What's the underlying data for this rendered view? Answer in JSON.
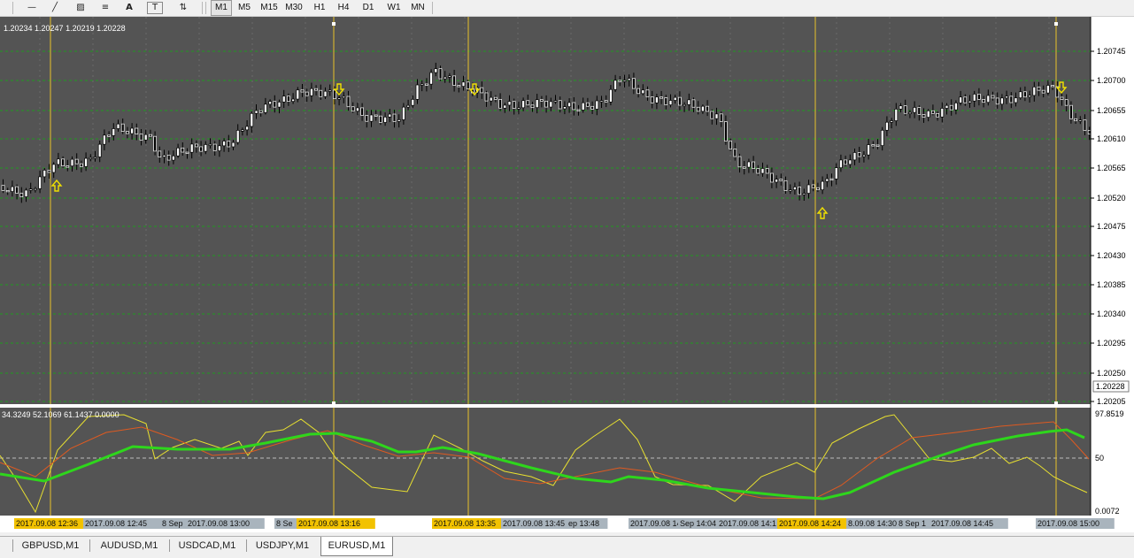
{
  "toolbar": {
    "tools": [
      {
        "name": "horizontal-line-icon",
        "glyph": "—"
      },
      {
        "name": "trendline-icon",
        "glyph": "╱"
      },
      {
        "name": "equidistant-channel-icon",
        "glyph": "▨"
      },
      {
        "name": "fibonacci-icon",
        "glyph": "≡"
      },
      {
        "name": "text-icon",
        "glyph": "A"
      },
      {
        "name": "text-label-icon",
        "glyph": "T"
      },
      {
        "name": "arrows-icon",
        "glyph": "⇅"
      }
    ],
    "timeframes": [
      "M1",
      "M5",
      "M15",
      "M30",
      "H1",
      "H4",
      "D1",
      "W1",
      "MN"
    ]
  },
  "chart": {
    "symbol": "EURUSD",
    "ohlc_text": "1.20234 1.20247 1.20219 1.20228",
    "price_ticks": [
      "1.20745",
      "1.20700",
      "1.20655",
      "1.20610",
      "1.20565",
      "1.20520",
      "1.20475",
      "1.20430",
      "1.20385",
      "1.20340",
      "1.20295",
      "1.20250",
      "1.20205"
    ],
    "current_price": "1.20228",
    "indicator_text": "34.3249 52.1069 61.1437 0.0000",
    "indicator_ticks": [
      "97.8519",
      "50",
      "0.0072"
    ],
    "time_labels": [
      {
        "text": "2017.09.08 12:36",
        "highlight": true
      },
      {
        "text": "2017.09.08 12:45",
        "highlight": false
      },
      {
        "text": "8 Sep",
        "highlight": false
      },
      {
        "text": "2017.09.08 13:00",
        "highlight": false
      },
      {
        "text": "8 Se",
        "highlight": false
      },
      {
        "text": "2017.09.08 13:16",
        "highlight": true
      },
      {
        "text": "2017.09.08 13:35",
        "highlight": true
      },
      {
        "text": "2017.09.08 13:45",
        "highlight": false
      },
      {
        "text": "ep 13:48",
        "highlight": false
      },
      {
        "text": "2017.09.08 14:00",
        "highlight": false
      },
      {
        "text": "Sep 14:04",
        "highlight": false
      },
      {
        "text": "2017.09.08 14:1",
        "highlight": false
      },
      {
        "text": "2017.09.08 14:24",
        "highlight": true
      },
      {
        "text": "8.09.08 14:30",
        "highlight": false
      },
      {
        "text": "8 Sep 1",
        "highlight": false
      },
      {
        "text": "2017.09.08 14:45",
        "highlight": false
      },
      {
        "text": "2017.09.08 15:00",
        "highlight": false
      }
    ],
    "colors": {
      "background": "#545454",
      "grid": "#1f9a1f",
      "candle": "#ffffff",
      "vline": "#e8c22a",
      "arrow": "#f0e000",
      "main_line": "#2ed61c",
      "signal_line": "#e05a20",
      "osc_line": "#e8e030"
    }
  },
  "tabs": {
    "items": [
      "GBPUSD,M1",
      "AUDUSD,M1",
      "USDCAD,M1",
      "USDJPY,M1",
      "EURUSD,M1"
    ],
    "active": "EURUSD,M1"
  }
}
